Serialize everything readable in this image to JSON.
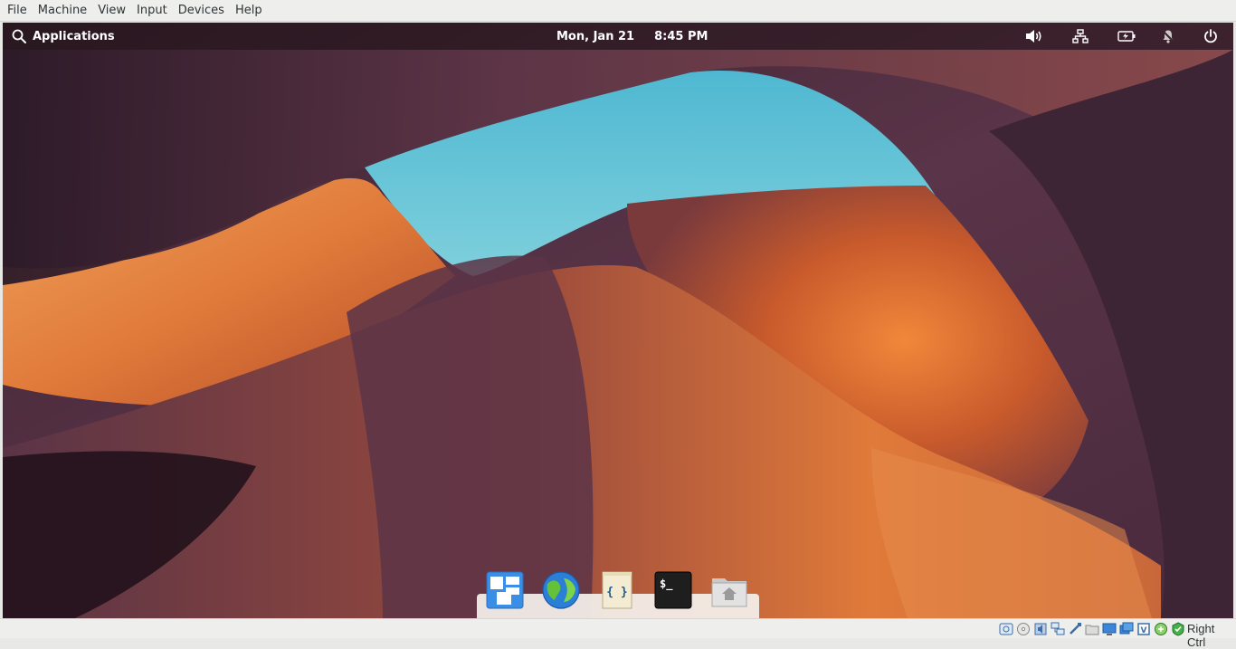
{
  "host_menu": {
    "file": "File",
    "machine": "Machine",
    "view": "View",
    "input": "Input",
    "devices": "Devices",
    "help": "Help"
  },
  "panel": {
    "applications_label": "Applications",
    "date": "Mon, Jan 21",
    "time": "8:45 PM",
    "indicators": [
      "volume-icon",
      "network-icon",
      "battery-icon",
      "notifications-off-icon",
      "power-icon"
    ]
  },
  "dock": {
    "items": [
      {
        "name": "multitasking-view",
        "icon": "multitasking-icon"
      },
      {
        "name": "web-browser",
        "icon": "globe-icon"
      },
      {
        "name": "code-editor",
        "icon": "code-braces-icon"
      },
      {
        "name": "terminal",
        "icon": "terminal-icon"
      },
      {
        "name": "files",
        "icon": "home-folder-icon"
      }
    ]
  },
  "status_bar": {
    "host_key_label": "Right Ctrl",
    "icons": [
      "hard-disk-icon",
      "optical-drive-icon",
      "audio-icon",
      "network-adapter-icon",
      "usb-icon",
      "shared-folders-icon",
      "display-icon",
      "video-capture-icon",
      "cpu-icon",
      "mouse-integration-icon",
      "keyboard-capture-icon"
    ]
  },
  "colors": {
    "panel_bg": "rgba(20,10,10,0.42)",
    "sky": "#55c1d8",
    "rock_orange": "#d86a2a",
    "rock_purple": "#4a2c3e"
  }
}
